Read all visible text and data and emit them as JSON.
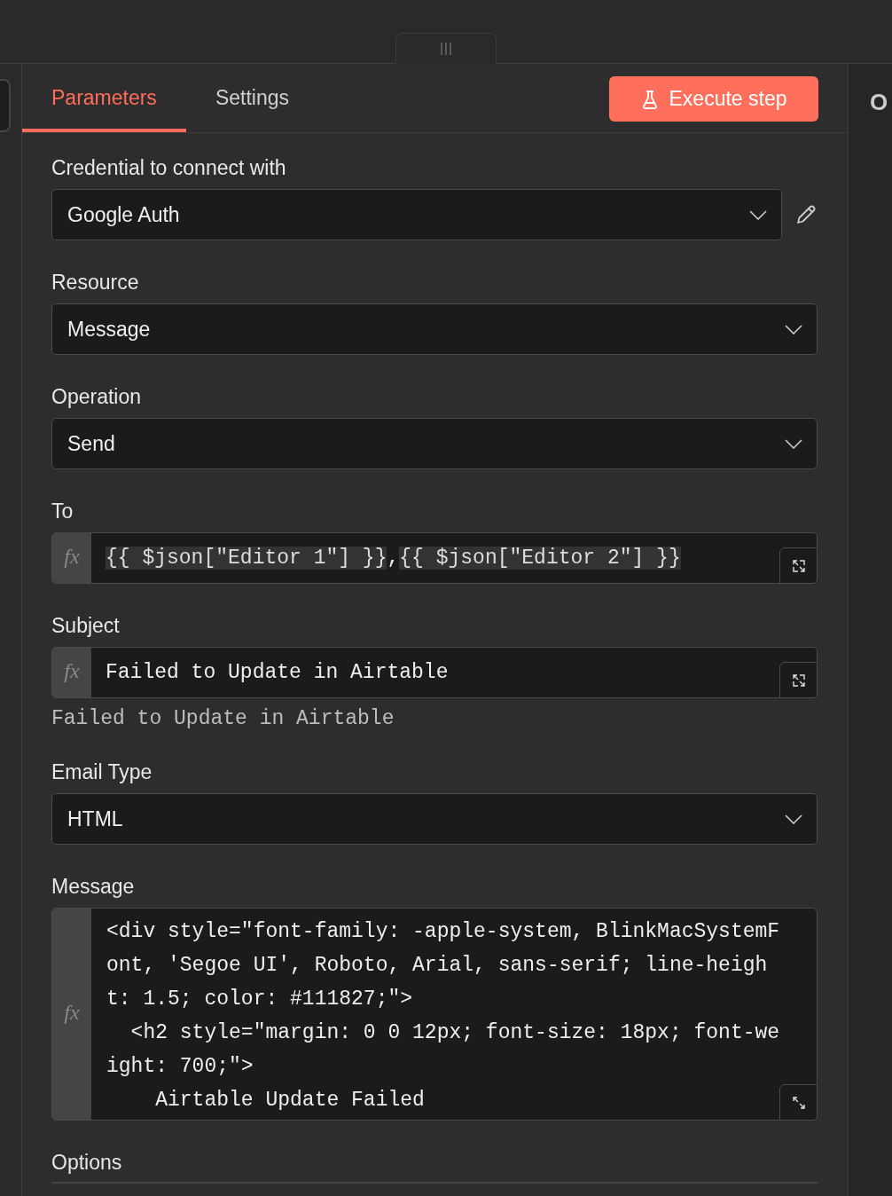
{
  "tabs": [
    {
      "label": "Parameters",
      "selected": true
    },
    {
      "label": "Settings",
      "selected": false
    }
  ],
  "execute_button": {
    "label": "Execute step"
  },
  "right_panel": {
    "text": "O"
  },
  "fields": [
    {
      "kind": "select",
      "label": "Credential to connect with",
      "value": "Google Auth",
      "editable": true
    },
    {
      "kind": "select",
      "label": "Resource",
      "value": "Message",
      "editable": false
    },
    {
      "kind": "select",
      "label": "Operation",
      "value": "Send",
      "editable": false
    },
    {
      "kind": "expression",
      "label": "To",
      "fx": "fx",
      "segments": [
        {
          "kind": "expression",
          "text": "{{ $json[\"Editor 1\"] }}"
        },
        {
          "kind": "plain",
          "text": ","
        },
        {
          "kind": "expression",
          "text": "{{ $json[\"Editor 2\"] }}"
        }
      ]
    },
    {
      "kind": "expression",
      "label": "Subject",
      "fx": "fx",
      "segments": [
        {
          "kind": "plain",
          "text": "Failed to Update in Airtable"
        }
      ],
      "preview": "Failed to Update in Airtable"
    },
    {
      "kind": "select",
      "label": "Email Type",
      "value": "HTML",
      "editable": false
    },
    {
      "kind": "code",
      "label": "Message",
      "fx": "fx",
      "lines": [
        "<div style=\"font-family: -apple-system, BlinkMacSystemF",
        "ont, 'Segoe UI', Roboto, Arial, sans-serif; line-heigh",
        "t: 1.5; color: #111827;\">",
        "  <h2 style=\"margin: 0 0 12px; font-size: 18px; font-we",
        "ight: 700;\">",
        "    Airtable Update Failed"
      ]
    }
  ],
  "options": {
    "label": "Options"
  }
}
